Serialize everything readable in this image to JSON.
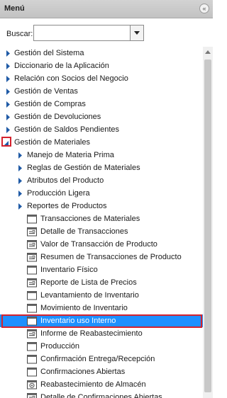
{
  "header": {
    "title": "Menú",
    "collapse_icon": "double-chevron-left-icon"
  },
  "search": {
    "label": "Buscar:",
    "value": "",
    "placeholder": ""
  },
  "colors": {
    "selected_bg": "#1e90ff",
    "highlight_border": "#d4232e",
    "arrow": "#1f5aa6"
  },
  "tree": {
    "top_items": [
      "Gestión del Sistema",
      "Diccionario de la Aplicación",
      "Relación con Socios del Negocio",
      "Gestión de Ventas",
      "Gestión de Compras",
      "Gestión de Devoluciones",
      "Gestión de Saldos Pendientes"
    ],
    "expanded": {
      "label": "Gestión de Materiales",
      "subfolders": [
        "Manejo de Materia Prima",
        "Reglas de Gestión de Materiales",
        "Atributos del Producto",
        "Producción Ligera",
        "Reportes de Productos"
      ],
      "items": [
        {
          "label": "Transacciones de Materiales",
          "icon": "window-icon"
        },
        {
          "label": "Detalle de Transacciones",
          "icon": "report-icon"
        },
        {
          "label": "Valor de Transacción de Producto",
          "icon": "report-icon"
        },
        {
          "label": "Resumen de Transacciones de Producto",
          "icon": "report-icon"
        },
        {
          "label": "Inventario Físico",
          "icon": "window-icon"
        },
        {
          "label": "Reporte de Lista de Precios",
          "icon": "report-icon"
        },
        {
          "label": "Levantamiento de Inventario",
          "icon": "window-icon"
        },
        {
          "label": "Movimiento de Inventario",
          "icon": "window-icon"
        },
        {
          "label": "Inventario uso Interno",
          "icon": "window-icon",
          "selected": true
        },
        {
          "label": "Informe de Reabastecimiento",
          "icon": "report-icon"
        },
        {
          "label": "Producción",
          "icon": "window-icon"
        },
        {
          "label": "Confirmación Entrega/Recepción",
          "icon": "window-icon"
        },
        {
          "label": "Confirmaciones Abiertas",
          "icon": "window-icon"
        },
        {
          "label": "Reabastecimiento de Almacén",
          "icon": "process-icon"
        },
        {
          "label": "Detalle de Confirmaciones Abiertas",
          "icon": "report-icon"
        }
      ]
    }
  }
}
